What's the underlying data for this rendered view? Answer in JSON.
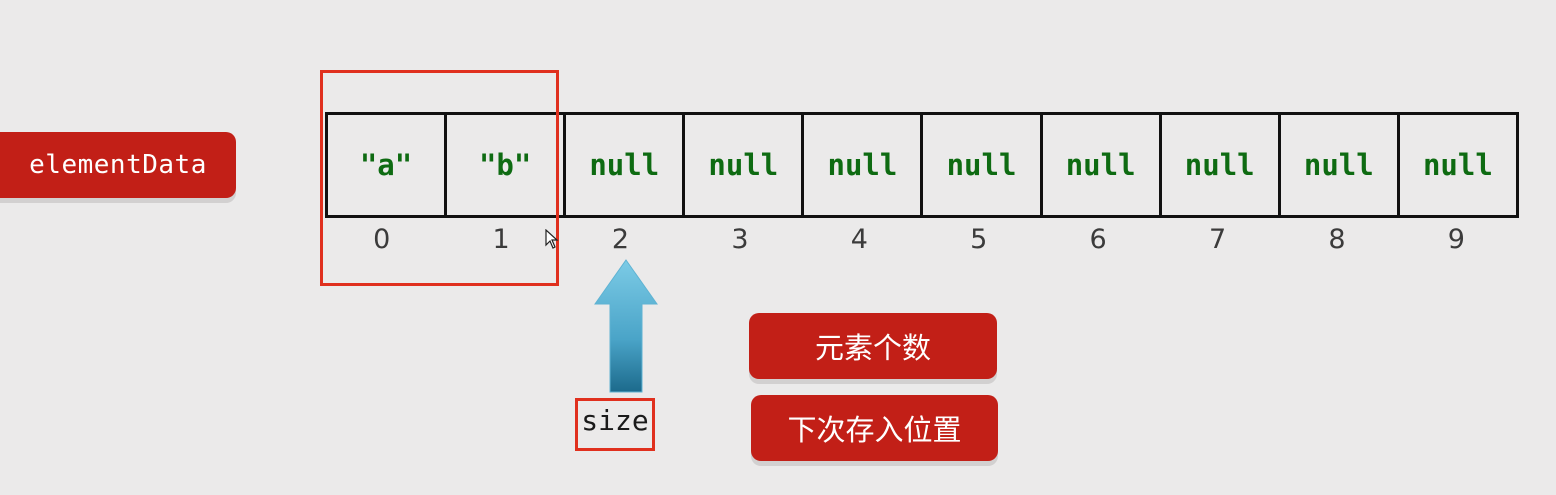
{
  "array_name": "elementData",
  "cells": [
    "\"a\"",
    "\"b\"",
    "null",
    "null",
    "null",
    "null",
    "null",
    "null",
    "null",
    "null"
  ],
  "indices": [
    "0",
    "1",
    "2",
    "3",
    "4",
    "5",
    "6",
    "7",
    "8",
    "9"
  ],
  "pointer_label": "size",
  "notes": {
    "count": "元素个数",
    "next_position": "下次存入位置"
  },
  "colors": {
    "label_background": "#c21f17",
    "value_text": "#0e6b12",
    "highlight_border": "#e0301e",
    "arrow_top": "#7ccbe6",
    "arrow_bottom": "#1c6a8c"
  },
  "size_value": 2
}
